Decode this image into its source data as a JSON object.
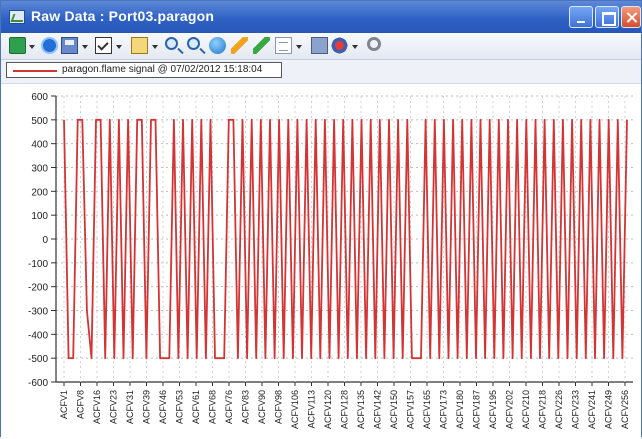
{
  "window": {
    "title": "Raw Data : Port03.paragon",
    "buttons": [
      "minimize",
      "maximize",
      "close"
    ]
  },
  "toolbar": {
    "icons": [
      "refresh-icon",
      "play-icon",
      "save-icon",
      "checkbox-icon",
      "document-icon",
      "zoom-in-icon",
      "search-icon",
      "globe-icon",
      "pencil-icon",
      "green-pencil-icon",
      "grid-icon",
      "print-icon",
      "record-icon",
      "settings-icon"
    ]
  },
  "legend": {
    "label": "paragon.flame signal @ 07/02/2012 15:18:04",
    "color": "#d33434"
  },
  "chart_data": {
    "type": "line",
    "title": "",
    "xlabel": "",
    "ylabel": "",
    "ylim": [
      -600,
      600
    ],
    "y_ticks": [
      600,
      500,
      400,
      300,
      200,
      100,
      0,
      -100,
      -200,
      -300,
      -400,
      -500,
      -600
    ],
    "x_tick_labels": [
      "ACFV1",
      "ACFV8",
      "ACFV16",
      "ACFV23",
      "ACFV31",
      "ACFV39",
      "ACFV46",
      "ACFV53",
      "ACFV61",
      "ACFV68",
      "ACFV76",
      "ACFV83",
      "ACFV90",
      "ACFV98",
      "ACFV106",
      "ACFV113",
      "ACFV120",
      "ACFV128",
      "ACFV135",
      "ACFV142",
      "ACFV150",
      "ACFV157",
      "ACFV165",
      "ACFV173",
      "ACFV180",
      "ACFV187",
      "ACFV195",
      "ACFV202",
      "ACFV210",
      "ACFV218",
      "ACFV226",
      "ACFV233",
      "ACFV241",
      "ACFV249",
      "ACFV256"
    ],
    "series": [
      {
        "name": "paragon.flame signal @ 07/02/2012 15:18:04",
        "color": "#d33434",
        "values": [
          500,
          -500,
          -500,
          500,
          500,
          -300,
          -500,
          500,
          500,
          -500,
          500,
          -500,
          500,
          -500,
          500,
          -500,
          500,
          500,
          -500,
          500,
          500,
          -500,
          -500,
          -500,
          500,
          -500,
          500,
          -500,
          500,
          -500,
          500,
          -500,
          500,
          -500,
          -500,
          -500,
          500,
          500,
          -500,
          500,
          -500,
          500,
          -500,
          500,
          -500,
          500,
          -500,
          500,
          -500,
          500,
          -500,
          500,
          -500,
          500,
          -500,
          500,
          -500,
          500,
          -500,
          500,
          -500,
          500,
          -500,
          500,
          -500,
          500,
          -500,
          500,
          -500,
          500,
          -500,
          500,
          -500,
          500,
          -500,
          500,
          -500,
          -500,
          -500,
          500,
          -500,
          500,
          -500,
          500,
          -500,
          500,
          -500,
          500,
          -500,
          500,
          -500,
          500,
          -500,
          500,
          -500,
          500,
          -500,
          500,
          -500,
          500,
          -500,
          500,
          -500,
          500,
          -500,
          500,
          -500,
          500,
          -500,
          500,
          -500,
          500,
          -500,
          500,
          -500,
          500,
          -500,
          500,
          -500,
          500,
          -500,
          500,
          -500,
          500
        ]
      }
    ],
    "grid": true,
    "legend_position": "top-left"
  }
}
